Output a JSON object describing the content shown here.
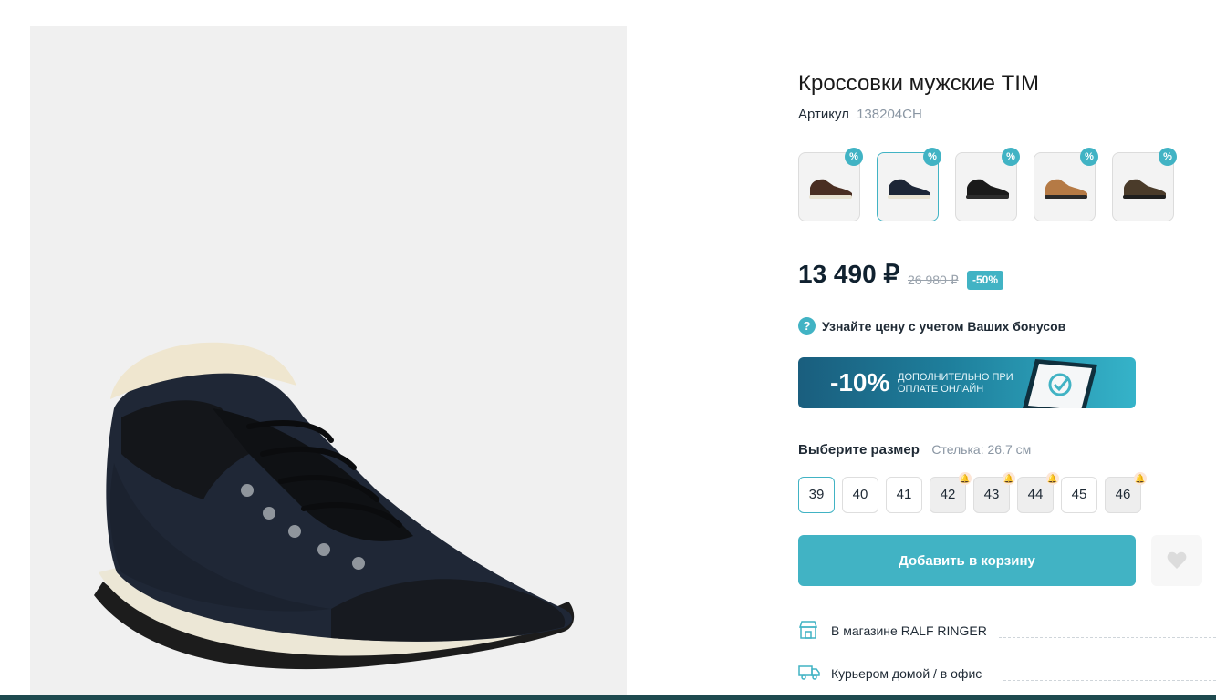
{
  "product": {
    "title": "Кроссовки мужские TIM",
    "sku_label": "Артикул",
    "sku_value": "138204CH",
    "image_icon": "sneaker-photo"
  },
  "variants": [
    {
      "color": "#4a2e22",
      "discount_icon": "%"
    },
    {
      "color": "#1d2636",
      "discount_icon": "%"
    },
    {
      "color": "#1a1a1a",
      "discount_icon": "%"
    },
    {
      "color": "#b57a45",
      "discount_icon": "%"
    },
    {
      "color": "#4a3b2a",
      "discount_icon": "%"
    }
  ],
  "pricing": {
    "price": "13 490 ₽",
    "old_price": "26 980 ₽",
    "discount": "-50%"
  },
  "bonus": {
    "icon": "?",
    "text": "Узнайте цену с учетом Ваших бонусов"
  },
  "promo": {
    "percent": "-10%",
    "line1": "ДОПОЛНИТЕЛЬНО ПРИ",
    "line2": "ОПЛАТЕ ОНЛАЙН"
  },
  "sizes": {
    "title": "Выберите размер",
    "insole": "Стелька: 26.7 см",
    "items": [
      {
        "label": "39",
        "selected": true,
        "notify": false
      },
      {
        "label": "40",
        "selected": false,
        "notify": false
      },
      {
        "label": "41",
        "selected": false,
        "notify": false
      },
      {
        "label": "42",
        "selected": false,
        "notify": true
      },
      {
        "label": "43",
        "selected": false,
        "notify": true
      },
      {
        "label": "44",
        "selected": false,
        "notify": true
      },
      {
        "label": "45",
        "selected": false,
        "notify": false
      },
      {
        "label": "46",
        "selected": false,
        "notify": true
      }
    ]
  },
  "actions": {
    "add_to_cart": "Добавить в корзину"
  },
  "delivery": {
    "store": "В магазине RALF RINGER",
    "courier": "Курьером домой / в офис"
  },
  "colors": {
    "accent": "#41b3c4",
    "text_dark": "#10212f",
    "muted": "#8a96a3"
  }
}
